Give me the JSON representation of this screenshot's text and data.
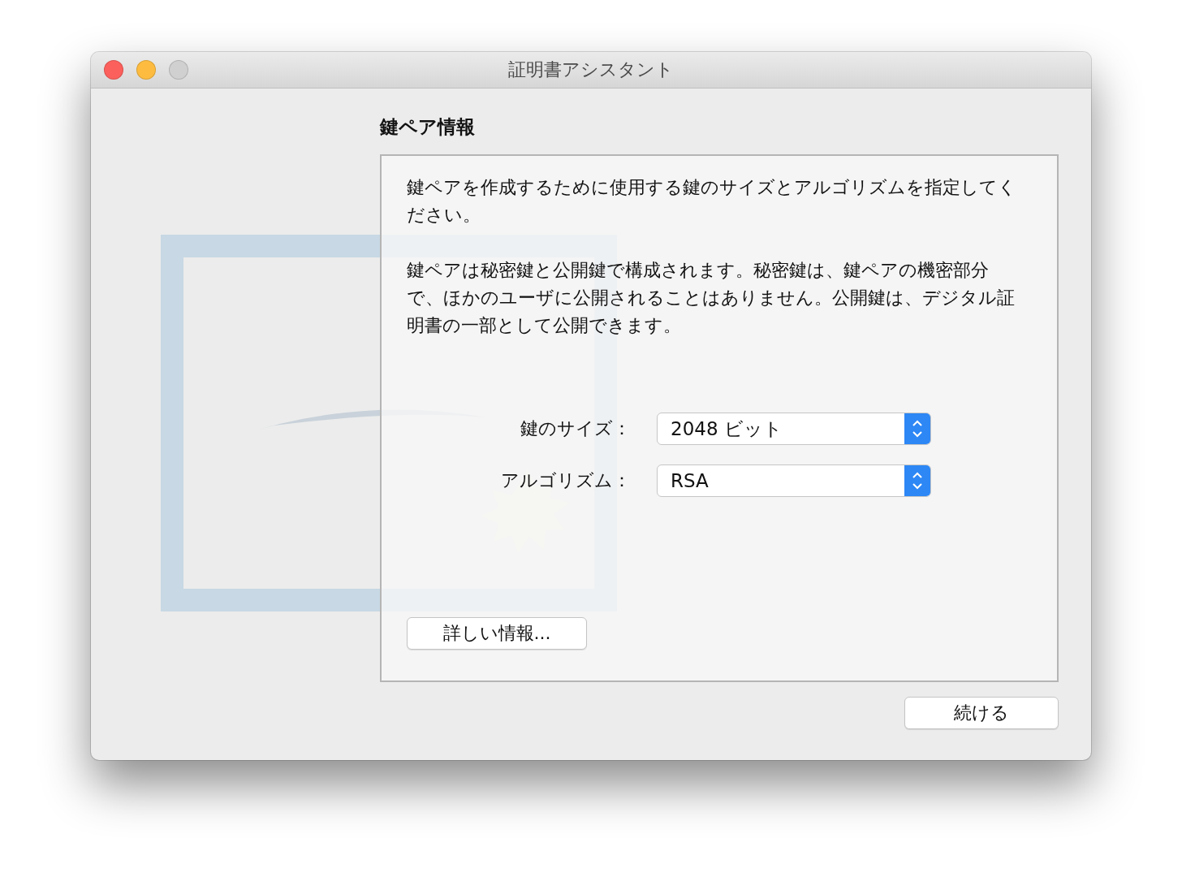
{
  "window": {
    "title": "証明書アシスタント",
    "controls": [
      {
        "kind": "close",
        "disabled": false
      },
      {
        "kind": "minimize",
        "disabled": false
      },
      {
        "kind": "zoom",
        "disabled": true
      }
    ]
  },
  "heading": "鍵ペア情報",
  "panel": {
    "paragraphs": [
      "鍵ペアを作成するために使用する鍵のサイズとアルゴリズムを指定してください。",
      "鍵ペアは秘密鍵と公開鍵で構成されます。秘密鍵は、鍵ペアの機密部分で、ほかのユーザに公開されることはありません。公開鍵は、デジタル証明書の一部として公開できます。"
    ],
    "fields": [
      {
        "label": "鍵のサイズ：",
        "value": "2048 ビット"
      },
      {
        "label": "アルゴリズム：",
        "value": "RSA"
      }
    ],
    "details_button": "詳しい情報..."
  },
  "continue_button": "続ける"
}
